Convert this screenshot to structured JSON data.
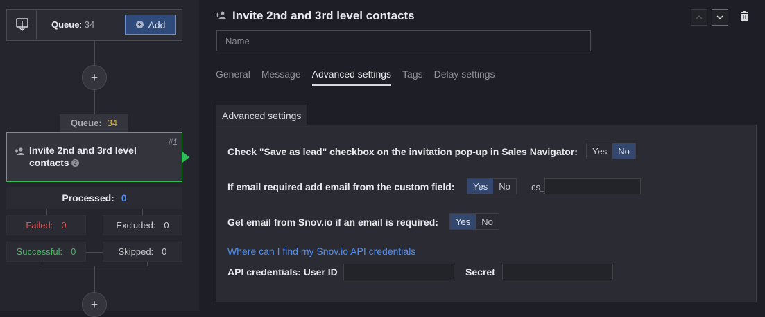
{
  "sidebar": {
    "queue": {
      "label": "Queue",
      "sep": ":",
      "count": "34"
    },
    "add_button": {
      "label": "Add",
      "icon": "plus-circle-icon"
    },
    "plus_glyph": "+",
    "queue_pill": {
      "label": "Queue:",
      "count": "34"
    },
    "step": {
      "title": "Invite 2nd and 3rd level contacts",
      "number": "#1",
      "icon": "add-user-icon",
      "help_glyph": "?"
    },
    "processed": {
      "label": "Processed:",
      "count": "0"
    },
    "failed": {
      "label": "Failed:",
      "count": "0"
    },
    "excluded": {
      "label": "Excluded:",
      "count": "0"
    },
    "successful": {
      "label": "Successful:",
      "count": "0"
    },
    "skipped": {
      "label": "Skipped:",
      "count": "0"
    }
  },
  "main": {
    "title": "Invite 2nd and 3rd level contacts",
    "name_placeholder": "Name",
    "tabs": [
      "General",
      "Message",
      "Advanced settings",
      "Tags",
      "Delay settings"
    ],
    "active_tab": "Advanced settings",
    "section_title": "Advanced settings",
    "settings": {
      "save_as_lead": {
        "label": "Check \"Save as lead\" checkbox on the invitation pop-up in Sales Navigator:",
        "yes": "Yes",
        "no": "No",
        "selected": "No"
      },
      "email_custom_field": {
        "label": "If email required add email from the custom field:",
        "yes": "Yes",
        "no": "No",
        "selected": "Yes",
        "prefix": "cs_"
      },
      "snovio": {
        "label": "Get email from Snov.io if an email is required:",
        "yes": "Yes",
        "no": "No",
        "selected": "Yes"
      },
      "link": "Where can I find my Snov.io API credentials",
      "user_id_label": "API credentials: User ID",
      "secret_label": "Secret"
    }
  },
  "colors": {
    "accent": "#4f8ef7",
    "success": "#2fbf5a",
    "failed": "#e05454",
    "queue_count": "#d4b042"
  }
}
